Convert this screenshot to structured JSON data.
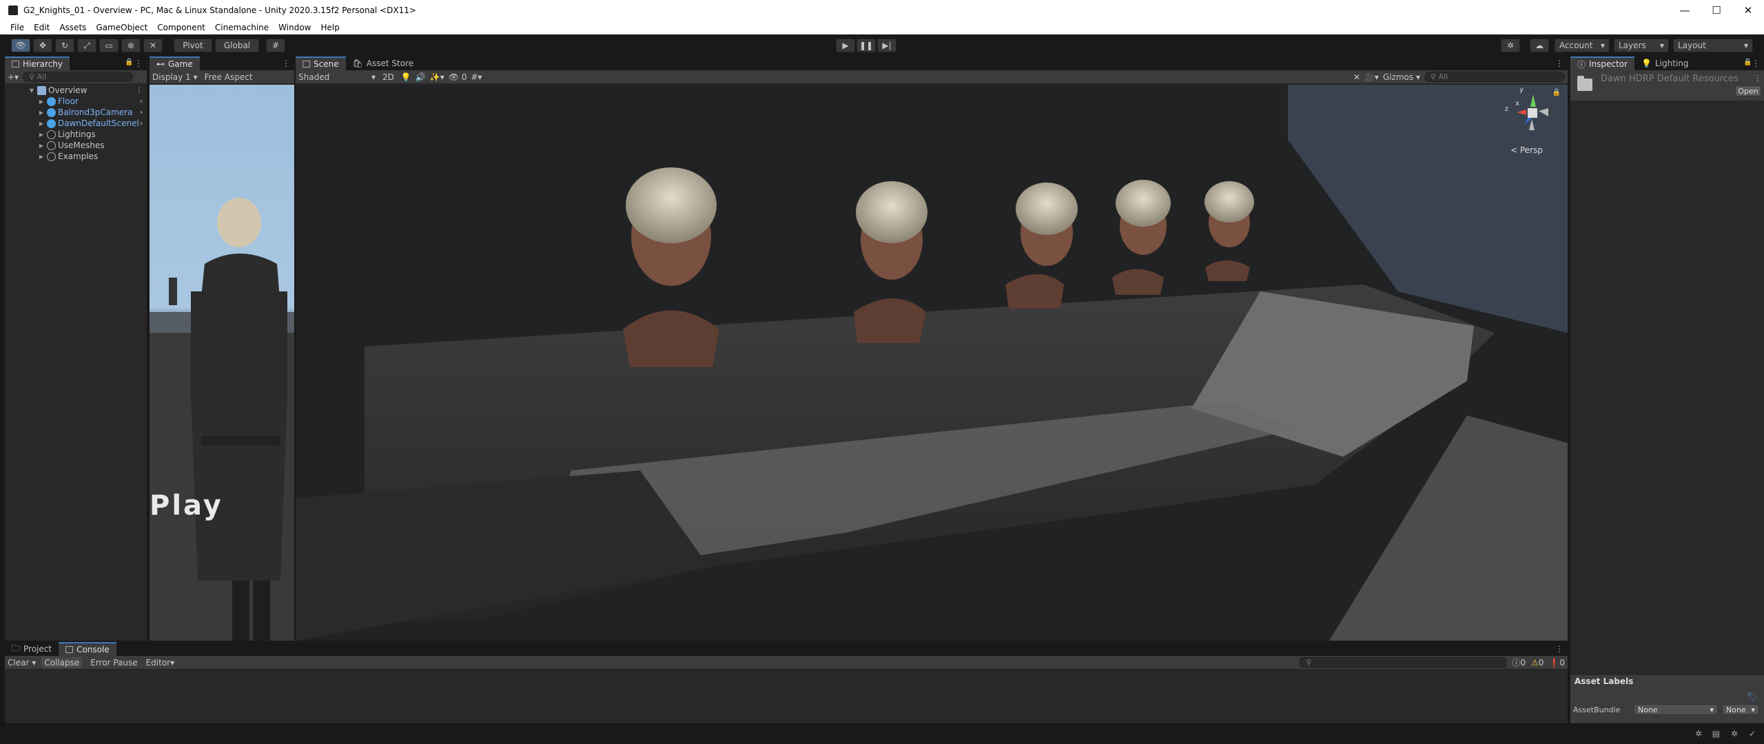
{
  "window": {
    "title": "G2_Knights_01 - Overview - PC, Mac & Linux Standalone - Unity 2020.3.15f2 Personal <DX11>",
    "min": "—",
    "max": "☐",
    "close": "✕"
  },
  "menu": [
    "File",
    "Edit",
    "Assets",
    "GameObject",
    "Component",
    "Cinemachine",
    "Window",
    "Help"
  ],
  "toolbar": {
    "pivot": "Pivot",
    "global": "Global",
    "account": "Account",
    "layers": "Layers",
    "layout": "Layout"
  },
  "hierarchy": {
    "tab": "Hierarchy",
    "search_placeholder": "All",
    "scene": "Overview",
    "items": [
      {
        "label": "Floor"
      },
      {
        "label": "Balrond3pCamera"
      },
      {
        "label": "DawnDefaultScenel"
      },
      {
        "label": "Lightings"
      },
      {
        "label": "UseMeshes"
      },
      {
        "label": "Examples"
      }
    ]
  },
  "game": {
    "tab": "Game",
    "display": "Display 1",
    "aspect": "Free Aspect",
    "overlay_text": "Play"
  },
  "scene": {
    "tab": "Scene",
    "tab2": "Asset Store",
    "shading": "Shaded",
    "mode_2d": "2D",
    "hidden_count": "0",
    "gizmos": "Gizmos",
    "search_placeholder": "All",
    "persp": "< Persp",
    "axis_y": "y",
    "axis_x": "x",
    "axis_z": "z"
  },
  "console": {
    "tab_project": "Project",
    "tab_console": "Console",
    "clear": "Clear",
    "collapse": "Collapse",
    "error_pause": "Error Pause",
    "editor": "Editor",
    "count_info": "0",
    "count_warn": "0",
    "count_error": "0"
  },
  "inspector": {
    "tab": "Inspector",
    "tab2": "Lighting",
    "asset_name": "Dawn HDRP Default Resources",
    "open": "Open",
    "asset_labels": "Asset Labels",
    "asset_bundle_label": "AssetBundle",
    "bundle_value": "None",
    "variant_value": "None"
  }
}
